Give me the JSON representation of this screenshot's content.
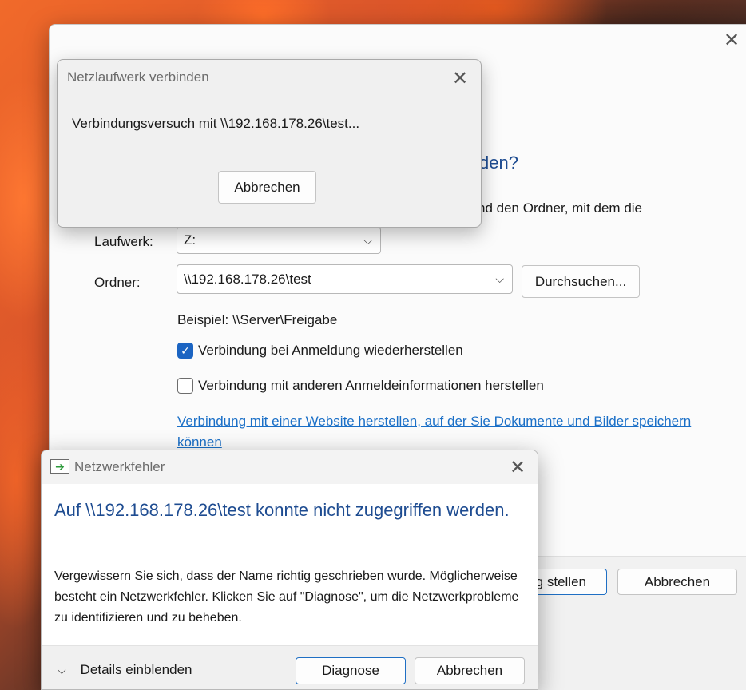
{
  "main_dialog": {
    "heading_visible": "den?",
    "desc_visible": "nd den Ordner, mit dem die",
    "drive_label": "Laufwerk:",
    "drive_value": "Z:",
    "folder_label": "Ordner:",
    "folder_value": "\\\\192.168.178.26\\test",
    "browse_button": "Durchsuchen...",
    "example": "Beispiel: \\\\Server\\Freigabe",
    "reconnect_label": "Verbindung bei Anmeldung wiederherstellen",
    "reconnect_checked": true,
    "other_credentials_label": "Verbindung mit anderen Anmeldeinformationen herstellen",
    "other_credentials_checked": false,
    "website_link": "Verbindung mit einer Website herstellen, auf der Sie Dokumente und Bilder speichern können",
    "finish_button_visible": "g stellen",
    "cancel_button": "Abbrechen"
  },
  "connect_dialog": {
    "title": "Netzlaufwerk verbinden",
    "message": "Verbindungsversuch mit \\\\192.168.178.26\\test...",
    "cancel_button": "Abbrechen"
  },
  "error_dialog": {
    "title": "Netzwerkfehler",
    "heading": "Auf \\\\192.168.178.26\\test konnte nicht zugegriffen werden.",
    "body": "Vergewissern Sie sich, dass der Name richtig geschrieben wurde. Möglicherweise besteht ein Netzwerkfehler. Klicken Sie auf \"Diagnose\", um die Netzwerkprobleme zu identifizieren und zu beheben.",
    "details_toggle": "Details einblenden",
    "diagnose_button": "Diagnose",
    "cancel_button": "Abbrechen"
  },
  "icons": {
    "close": "close-icon",
    "chevron": "chevron-down-icon",
    "check": "checkmark-icon",
    "app": "network-drive-icon"
  },
  "colors": {
    "heading_blue": "#1e4c91",
    "link_blue": "#1a6fc7",
    "checkbox_blue": "#1b64c2"
  }
}
